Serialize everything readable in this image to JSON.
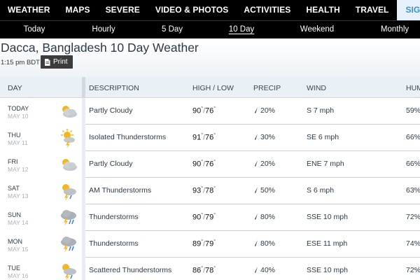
{
  "topnav": {
    "items": [
      "WEATHER",
      "MAPS",
      "SEVERE",
      "VIDEO & PHOTOS",
      "ACTIVITIES",
      "HEALTH",
      "TRAVEL"
    ],
    "signup": "SIGN UP FOR NEW"
  },
  "subnav": {
    "items": [
      "Today",
      "Hourly",
      "5 Day",
      "10 Day",
      "Weekend",
      "Monthly"
    ],
    "active": "10 Day"
  },
  "page": {
    "title": "Dacca, Bangladesh 10 Day Weather",
    "time": "1:15 pm BDT",
    "print_label": "Print"
  },
  "table": {
    "headers": {
      "day": "DAY",
      "description": "DESCRIPTION",
      "highlow": "HIGH / LOW",
      "precip": "PRECIP",
      "wind": "WIND",
      "humidity": "HUM"
    },
    "rows": [
      {
        "day": "TODAY",
        "date": "MAY 10",
        "icon": "partly-cloudy-icon",
        "desc": "Partly Cloudy",
        "high": "90",
        "low": "76",
        "precip": "20%",
        "wind": "S 7 mph",
        "humidity": "59%"
      },
      {
        "day": "THU",
        "date": "MAY 11",
        "icon": "isolated-thunderstorms-icon",
        "desc": "Isolated Thunderstorms",
        "high": "91",
        "low": "76",
        "precip": "30%",
        "wind": "SE 6 mph",
        "humidity": "66%"
      },
      {
        "day": "FRI",
        "date": "MAY 12",
        "icon": "partly-cloudy-icon",
        "desc": "Partly Cloudy",
        "high": "90",
        "low": "76",
        "precip": "20%",
        "wind": "ENE 7 mph",
        "humidity": "66%"
      },
      {
        "day": "SAT",
        "date": "MAY 13",
        "icon": "am-thunderstorms-icon",
        "desc": "AM Thunderstorms",
        "high": "93",
        "low": "78",
        "precip": "50%",
        "wind": "S 6 mph",
        "humidity": "63%"
      },
      {
        "day": "SUN",
        "date": "MAY 14",
        "icon": "thunderstorms-icon",
        "desc": "Thunderstorms",
        "high": "90",
        "low": "79",
        "precip": "80%",
        "wind": "SSE 10 mph",
        "humidity": "72%"
      },
      {
        "day": "MON",
        "date": "MAY 15",
        "icon": "thunderstorms-icon",
        "desc": "Thunderstorms",
        "high": "89",
        "low": "79",
        "precip": "80%",
        "wind": "ESE 11 mph",
        "humidity": "74%"
      },
      {
        "day": "TUE",
        "date": "MAY 16",
        "icon": "scattered-thunderstorms-icon",
        "desc": "Scattered Thunderstorms",
        "high": "86",
        "low": "78",
        "precip": "40%",
        "wind": "SSE 10 mph",
        "humidity": "72%"
      }
    ]
  },
  "colors": {
    "nav_bg": "#000000",
    "signup_text": "#3b8fd6",
    "header_bg": "#e9f0f6",
    "sun": "#f5b51e",
    "cloud": "#b8bec4",
    "rain": "#3b7dd8"
  }
}
